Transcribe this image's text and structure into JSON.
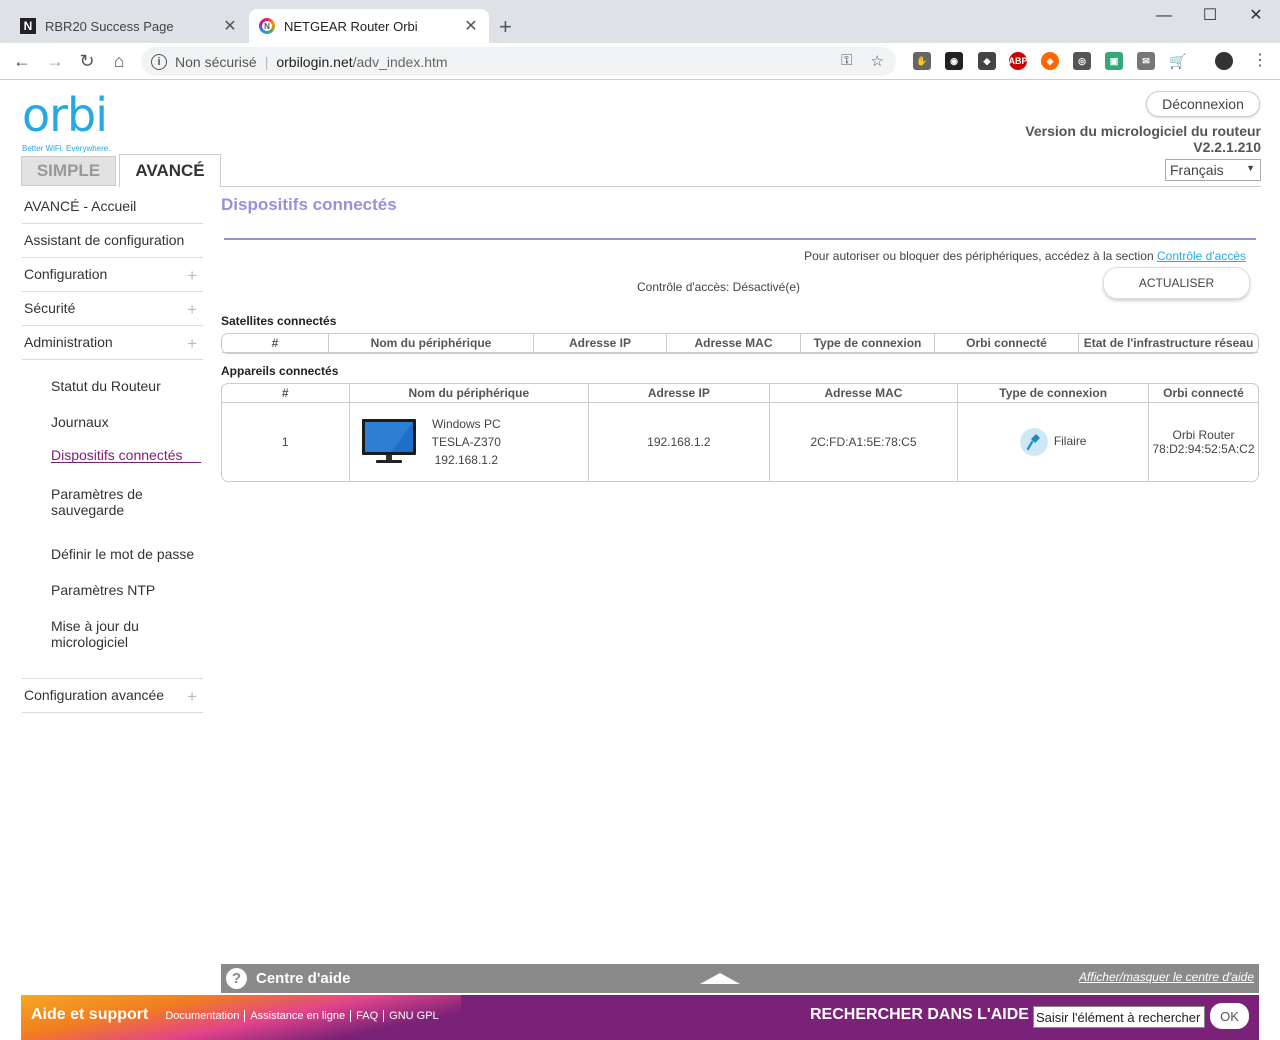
{
  "browser": {
    "tabs": [
      {
        "title": "RBR20 Success Page"
      },
      {
        "title": "NETGEAR Router Orbi"
      }
    ],
    "new_tab": "+",
    "window_controls": {
      "minimize": "—",
      "maximize": "☐",
      "close": "✕"
    },
    "security_label": "Non sécurisé",
    "url_host": "orbilogin.net",
    "url_path": "/adv_index.htm"
  },
  "header": {
    "logo_text": "orbi",
    "logo_tagline": "Better WiFi. Everywhere.",
    "logout_label": "Déconnexion",
    "firmware_label": "Version du micrologiciel du routeur",
    "firmware_version": "V2.2.1.210",
    "language": "Français",
    "mode_tabs": {
      "simple": "SIMPLE",
      "advanced": "AVANCÉ"
    }
  },
  "sidebar": {
    "items": [
      {
        "label": "AVANCÉ - Accueil"
      },
      {
        "label": "Assistant de configuration"
      },
      {
        "label": "Configuration",
        "expand": "+"
      },
      {
        "label": "Sécurité",
        "expand": "+"
      },
      {
        "label": "Administration",
        "expand": "+"
      }
    ],
    "admin_subitems": [
      {
        "label": "Statut du Routeur"
      },
      {
        "label": "Journaux"
      },
      {
        "label": "Dispositifs connectés"
      },
      {
        "label": "Paramètres de sauvegarde"
      },
      {
        "label": "Définir le mot de passe"
      },
      {
        "label": "Paramètres NTP"
      },
      {
        "label": "Mise à jour du micrologiciel"
      }
    ],
    "advanced_config": {
      "label": "Configuration avancée",
      "expand": "+"
    }
  },
  "main": {
    "title": "Dispositifs connectés",
    "access_note": "Pour autoriser ou bloquer des périphériques, accédez à la section",
    "access_link": "Contrôle d'accès",
    "access_status": "Contrôle d'accès: Désactivé(e)",
    "refresh_label": "ACTUALISER",
    "satellites": {
      "label": "Satellites connectés",
      "columns": [
        "#",
        "Nom du périphérique",
        "Adresse IP",
        "Adresse MAC",
        "Type de connexion",
        "Orbi connecté",
        "Etat de l'infrastructure réseau"
      ]
    },
    "devices": {
      "label": "Appareils connectés",
      "columns": [
        "#",
        "Nom du périphérique",
        "Adresse IP",
        "Adresse MAC",
        "Type de connexion",
        "Orbi connecté"
      ],
      "rows": [
        {
          "index": "1",
          "name_line1": "Windows PC",
          "name_line2": "TESLA-Z370",
          "name_line3": "192.168.1.2",
          "ip": "192.168.1.2",
          "mac": "2C:FD:A1:5E:78:C5",
          "connection": "Filaire",
          "orbi_line1": "Orbi Router",
          "orbi_line2": "78:D2:94:52:5A:C2"
        }
      ]
    }
  },
  "help": {
    "q": "?",
    "title": "Centre d'aide",
    "toggle": "Afficher/masquer le centre d'aide"
  },
  "footer": {
    "title": "Aide et support",
    "links": [
      "Documentation",
      "Assistance en ligne",
      "FAQ",
      "GNU GPL"
    ],
    "search_label": "RECHERCHER DANS L'AIDE",
    "search_value": "Saisir l'élément à rechercher",
    "ok_label": "OK"
  }
}
